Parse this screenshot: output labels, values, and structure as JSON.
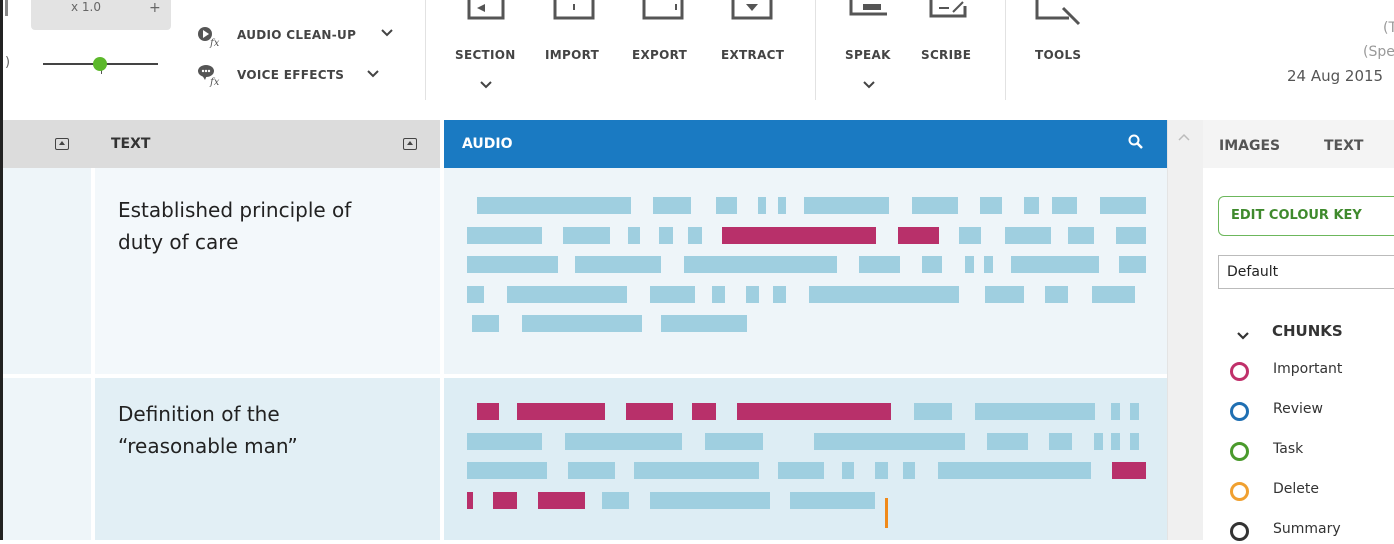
{
  "ribbon": {
    "speed_value": "x 1.0",
    "speed_plus": "+",
    "audio_cleanup": "AUDIO CLEAN-UP",
    "voice_effects": "VOICE EFFECTS",
    "commands": [
      "SECTION",
      "IMPORT",
      "EXPORT",
      "EXTRACT",
      "SPEAK",
      "SCRIBE",
      "TOOLS"
    ],
    "date": "24 Aug 2015",
    "partial_top": "(T",
    "partial_mid": "(Spe"
  },
  "headers": {
    "text": "TEXT",
    "audio": "AUDIO",
    "panel_tabs": [
      "IMAGES",
      "TEXT"
    ]
  },
  "notes": [
    {
      "line1": "Established principle of",
      "line2": "duty of care"
    },
    {
      "line1": "Definition of the",
      "line2": "“reasonable man”"
    }
  ],
  "panel": {
    "edit_colour_key": "EDIT COLOUR KEY",
    "colour_key_selected": "Default",
    "chunks_heading": "CHUNKS",
    "legend": [
      {
        "label": "Important",
        "color": "#c0306a"
      },
      {
        "label": "Review",
        "color": "#1f6fb2"
      },
      {
        "label": "Task",
        "color": "#4a9a2c"
      },
      {
        "label": "Delete",
        "color": "#f0a030"
      },
      {
        "label": "Summary",
        "color": "#333333"
      }
    ]
  },
  "colors": {
    "audio_header": "#1a7ac2",
    "chunk_plain": "#9fcfe0",
    "chunk_important": "#b8306a",
    "playhead": "#f08a1a",
    "slider_dot": "#5cb82b"
  },
  "icons": [
    "audio-cleanup-icon",
    "voice-effects-icon",
    "section-icon",
    "import-icon",
    "export-icon",
    "extract-icon",
    "speak-icon",
    "scribe-icon",
    "tools-icon",
    "zoom-icon",
    "collapse-icon",
    "chevron-down-icon",
    "scroll-up-icon"
  ]
}
